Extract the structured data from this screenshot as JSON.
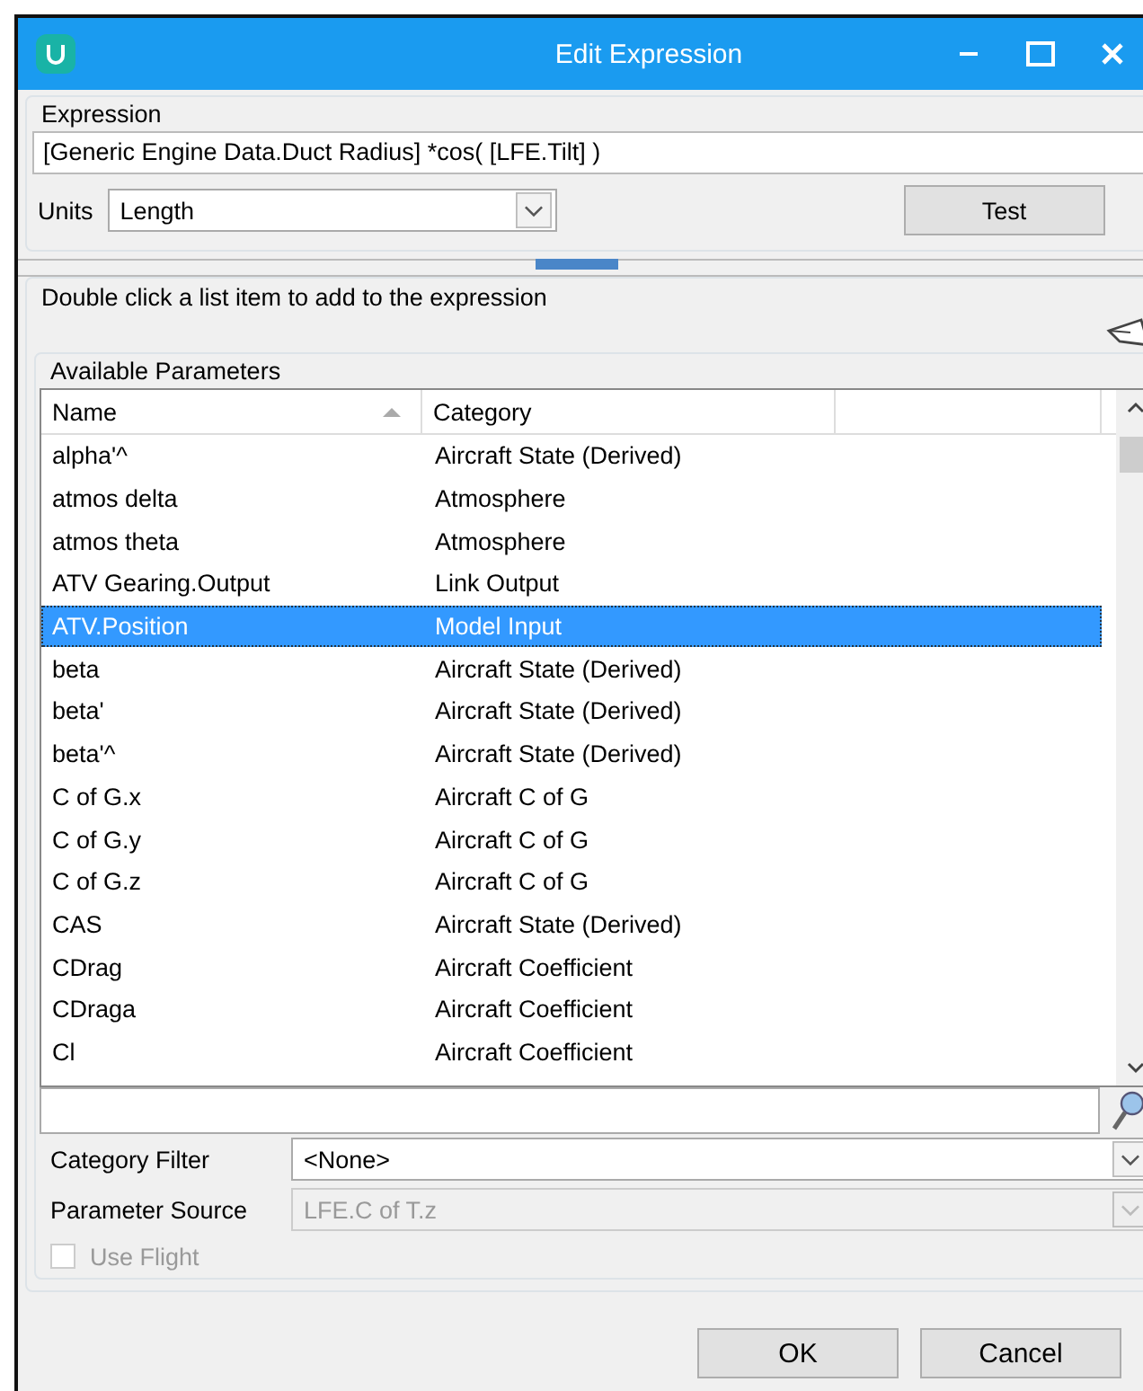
{
  "window": {
    "title": "Edit Expression"
  },
  "expression": {
    "label": "Expression",
    "value": "[Generic Engine Data.Duct Radius] *cos( [LFE.Tilt] )"
  },
  "units": {
    "label": "Units",
    "value": "Length"
  },
  "test_button": "Test",
  "hint": "Double click a list item to add to the expression",
  "parameters": {
    "label": "Available Parameters",
    "columns": [
      {
        "label": "Name",
        "sorted": true
      },
      {
        "label": "Category",
        "sorted": false
      }
    ],
    "rows": [
      {
        "name": "alpha'^",
        "category": "Aircraft State (Derived)",
        "selected": false
      },
      {
        "name": "atmos delta",
        "category": "Atmosphere",
        "selected": false
      },
      {
        "name": "atmos theta",
        "category": "Atmosphere",
        "selected": false
      },
      {
        "name": "ATV Gearing.Output",
        "category": "Link Output",
        "selected": false
      },
      {
        "name": "ATV.Position",
        "category": "Model Input",
        "selected": true
      },
      {
        "name": "beta",
        "category": "Aircraft State (Derived)",
        "selected": false
      },
      {
        "name": "beta'",
        "category": "Aircraft State (Derived)",
        "selected": false
      },
      {
        "name": "beta'^",
        "category": "Aircraft State (Derived)",
        "selected": false
      },
      {
        "name": "C of G.x",
        "category": "Aircraft C of G",
        "selected": false
      },
      {
        "name": "C of G.y",
        "category": "Aircraft C of G",
        "selected": false
      },
      {
        "name": "C of G.z",
        "category": "Aircraft C of G",
        "selected": false
      },
      {
        "name": "CAS",
        "category": "Aircraft State (Derived)",
        "selected": false
      },
      {
        "name": "CDrag",
        "category": "Aircraft Coefficient",
        "selected": false
      },
      {
        "name": "CDraga",
        "category": "Aircraft Coefficient",
        "selected": false
      },
      {
        "name": "Cl",
        "category": "Aircraft Coefficient",
        "selected": false
      }
    ]
  },
  "category_filter": {
    "label": "Category Filter",
    "value": "<None>",
    "disabled": false
  },
  "parameter_source": {
    "label": "Parameter Source",
    "value": "LFE.C of T.z",
    "disabled": true
  },
  "use_flight": {
    "label": "Use Flight",
    "checked": false,
    "disabled": true
  },
  "buttons": [
    "OK",
    "Cancel"
  ]
}
